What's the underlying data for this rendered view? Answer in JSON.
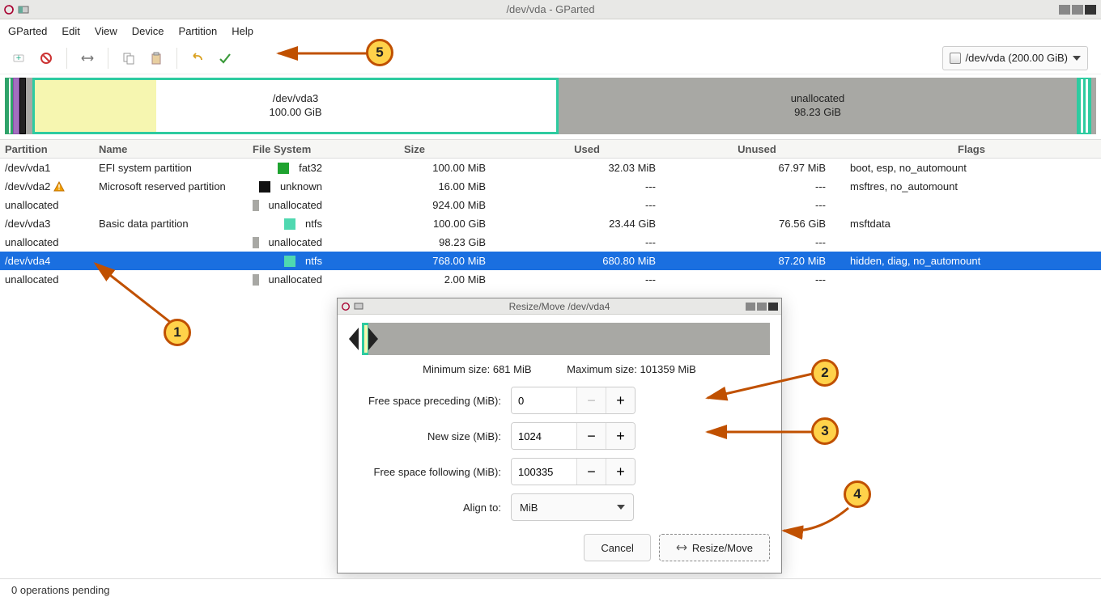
{
  "titlebar": {
    "title": "/dev/vda - GParted"
  },
  "menu": {
    "items": [
      "GParted",
      "Edit",
      "View",
      "Device",
      "Partition",
      "Help"
    ]
  },
  "device_picker": {
    "label": "/dev/vda (200.00 GiB)"
  },
  "diskmap": {
    "vda3": {
      "name": "/dev/vda3",
      "size": "100.00 GiB"
    },
    "unalloc": {
      "name": "unallocated",
      "size": "98.23 GiB"
    }
  },
  "columns": {
    "partition": "Partition",
    "name": "Name",
    "fs": "File System",
    "size": "Size",
    "used": "Used",
    "unused": "Unused",
    "flags": "Flags"
  },
  "rows": [
    {
      "part": "/dev/vda1",
      "warn": false,
      "name": "EFI system partition",
      "fs": "fat32",
      "sw": "sw-fat32",
      "size": "100.00 MiB",
      "used": "32.03 MiB",
      "unused": "67.97 MiB",
      "flags": "boot, esp, no_automount",
      "sel": false
    },
    {
      "part": "/dev/vda2",
      "warn": true,
      "name": "Microsoft reserved partition",
      "fs": "unknown",
      "sw": "sw-unknown",
      "size": "16.00 MiB",
      "used": "---",
      "unused": "---",
      "flags": "msftres, no_automount",
      "sel": false
    },
    {
      "part": "unallocated",
      "warn": false,
      "name": "",
      "fs": "unallocated",
      "sw": "sw-unalloc",
      "size": "924.00 MiB",
      "used": "---",
      "unused": "---",
      "flags": "",
      "sel": false
    },
    {
      "part": "/dev/vda3",
      "warn": false,
      "name": "Basic data partition",
      "fs": "ntfs",
      "sw": "sw-ntfs",
      "size": "100.00 GiB",
      "used": "23.44 GiB",
      "unused": "76.56 GiB",
      "flags": "msftdata",
      "sel": false
    },
    {
      "part": "unallocated",
      "warn": false,
      "name": "",
      "fs": "unallocated",
      "sw": "sw-unalloc",
      "size": "98.23 GiB",
      "used": "---",
      "unused": "---",
      "flags": "",
      "sel": false
    },
    {
      "part": "/dev/vda4",
      "warn": false,
      "name": "",
      "fs": "ntfs",
      "sw": "sw-ntfs",
      "size": "768.00 MiB",
      "used": "680.80 MiB",
      "unused": "87.20 MiB",
      "flags": "hidden, diag, no_automount",
      "sel": true
    },
    {
      "part": "unallocated",
      "warn": false,
      "name": "",
      "fs": "unallocated",
      "sw": "sw-unalloc",
      "size": "2.00 MiB",
      "used": "---",
      "unused": "---",
      "flags": "",
      "sel": false
    }
  ],
  "dialog": {
    "title": "Resize/Move /dev/vda4",
    "min": "Minimum size: 681 MiB",
    "max": "Maximum size: 101359 MiB",
    "labels": {
      "preceding": "Free space preceding (MiB):",
      "newsize": "New size (MiB):",
      "following": "Free space following (MiB):",
      "align": "Align to:"
    },
    "values": {
      "preceding": "0",
      "newsize": "1024",
      "following": "100335",
      "align": "MiB"
    },
    "buttons": {
      "cancel": "Cancel",
      "resize": "Resize/Move"
    }
  },
  "status": {
    "text": "0 operations pending"
  },
  "annotations": {
    "a1": "1",
    "a2": "2",
    "a3": "3",
    "a4": "4",
    "a5": "5"
  }
}
